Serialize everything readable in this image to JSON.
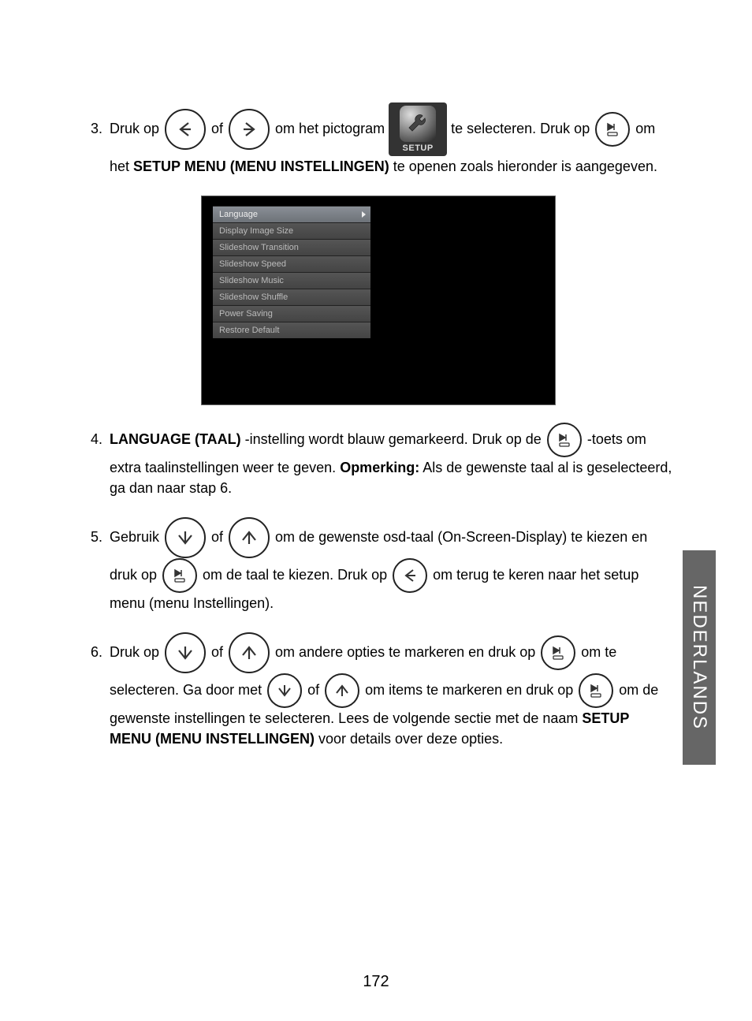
{
  "icons": {
    "setup_label": "SETUP"
  },
  "step3": {
    "num": "3.",
    "t1": "Druk op ",
    "of": " of ",
    "t2": " om het pictogram ",
    "t3": " te selecteren. Druk op ",
    "t4": " om het ",
    "bold1": "SETUP MENU (MENU INSTELLINGEN)",
    "t5": " te openen zoals hieronder is aangegeven."
  },
  "menu": {
    "items": [
      {
        "label": "Language",
        "selected": true
      },
      {
        "label": "Display Image Size",
        "selected": false
      },
      {
        "label": "Slideshow Transition",
        "selected": false
      },
      {
        "label": "Slideshow Speed",
        "selected": false
      },
      {
        "label": "Slideshow Music",
        "selected": false
      },
      {
        "label": "Slideshow Shuffle",
        "selected": false
      },
      {
        "label": "Power Saving",
        "selected": false
      },
      {
        "label": "Restore Default",
        "selected": false
      }
    ]
  },
  "step4": {
    "num": "4.",
    "bold1": "LANGUAGE (TAAL)",
    "t1": " -instelling wordt blauw gemarkeerd. Druk op de ",
    "t2": " -toets om extra taalinstellingen weer te geven. ",
    "bold2": "Opmerking:",
    "t3": " Als de gewenste taal al is geselecteerd, ga dan naar stap 6."
  },
  "step5": {
    "num": "5.",
    "t1": "Gebruik ",
    "of": " of ",
    "t2": " om de gewenste osd-taal (On-Screen-Display) te kiezen en druk op ",
    "t3": " om de taal te kiezen. Druk op ",
    "t4": " om terug te keren naar het setup menu (menu Instellingen)."
  },
  "step6": {
    "num": "6.",
    "t1": "Druk op ",
    "of": " of ",
    "t2": " om andere opties te markeren en druk op ",
    "t3": " om te selecteren. Ga door met ",
    "t4": " om items te markeren en druk op ",
    "t5": " om de gewenste instellingen te selecteren. Lees de volgende sectie met de naam ",
    "bold1": "SETUP MENU (MENU INSTELLINGEN)",
    "t6": " voor details over deze opties."
  },
  "side_tab": "NEDERLANDS",
  "page_number": "172"
}
